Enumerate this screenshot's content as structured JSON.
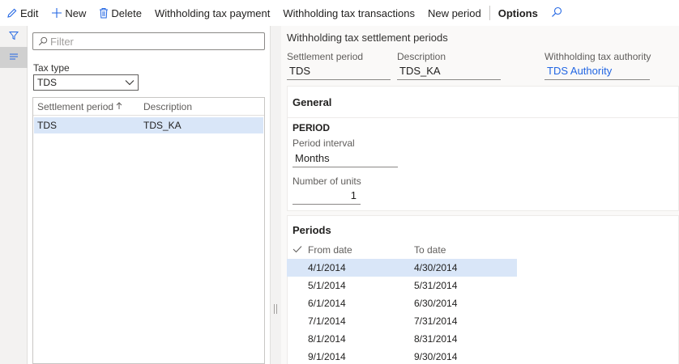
{
  "toolbar": {
    "edit": "Edit",
    "new": "New",
    "delete": "Delete",
    "withholding_tax_payment": "Withholding tax payment",
    "withholding_tax_transactions": "Withholding tax transactions",
    "new_period": "New period",
    "options": "Options"
  },
  "list": {
    "filter_placeholder": "Filter",
    "tax_type_label": "Tax type",
    "tax_type_value": "TDS",
    "columns": {
      "settlement_period": "Settlement period",
      "description": "Description"
    },
    "rows": [
      {
        "settlement_period": "TDS",
        "description": "TDS_KA"
      }
    ]
  },
  "detail": {
    "title": "Withholding tax settlement periods",
    "settlement_period_label": "Settlement period",
    "settlement_period_value": "TDS",
    "description_label": "Description",
    "description_value": "TDS_KA",
    "authority_label": "Withholding tax authority",
    "authority_value": "TDS Authority",
    "general": {
      "title": "General",
      "period_heading": "PERIOD",
      "period_interval_label": "Period interval",
      "period_interval_value": "Months",
      "number_of_units_label": "Number of units",
      "number_of_units_value": "1"
    },
    "periods": {
      "title": "Periods",
      "columns": {
        "from_date": "From date",
        "to_date": "To date"
      },
      "rows": [
        {
          "from": "4/1/2014",
          "to": "4/30/2014"
        },
        {
          "from": "5/1/2014",
          "to": "5/31/2014"
        },
        {
          "from": "6/1/2014",
          "to": "6/30/2014"
        },
        {
          "from": "7/1/2014",
          "to": "7/31/2014"
        },
        {
          "from": "8/1/2014",
          "to": "8/31/2014"
        },
        {
          "from": "9/1/2014",
          "to": "9/30/2014"
        }
      ]
    }
  },
  "colors": {
    "accent": "#2266e3",
    "selection": "#d9e6f8"
  }
}
